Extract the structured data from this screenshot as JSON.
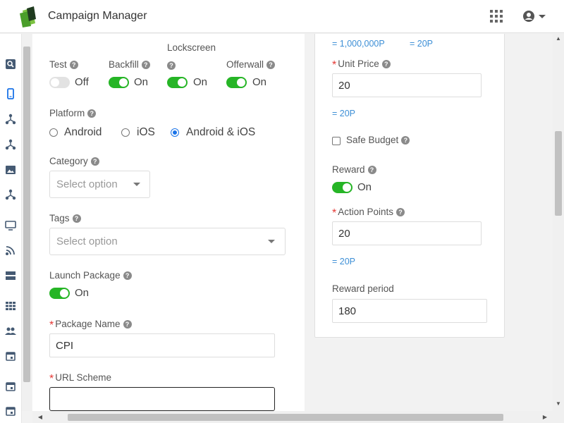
{
  "header": {
    "title": "Campaign Manager",
    "apps_icon": "grid-icon",
    "user_icon": "account-circle-icon"
  },
  "sidebar": {
    "icons": [
      "search-icon",
      "mobile-icon",
      "network-icon",
      "network-icon",
      "image-icon",
      "network-icon",
      "monitor-icon",
      "rss-icon",
      "storage-icon",
      "grid-icon",
      "people-icon",
      "calendar-icon",
      "calendar-icon",
      "calendar-icon"
    ]
  },
  "toggles": {
    "test": {
      "label": "Test",
      "state": "Off",
      "on": false
    },
    "backfill": {
      "label": "Backfill",
      "state": "On",
      "on": true
    },
    "lockscreen": {
      "label": "Lockscreen",
      "state": "On",
      "on": true
    },
    "offerwall": {
      "label": "Offerwall",
      "state": "On",
      "on": true
    }
  },
  "platform": {
    "label": "Platform",
    "options": [
      "Android",
      "iOS",
      "Android & iOS"
    ],
    "selected": "Android & iOS"
  },
  "category": {
    "label": "Category",
    "placeholder": "Select option"
  },
  "tags": {
    "label": "Tags",
    "placeholder": "Select option"
  },
  "launch_package": {
    "label": "Launch Package",
    "state": "On",
    "on": true
  },
  "package_name": {
    "label": "Package Name",
    "value": "CPI"
  },
  "url_scheme": {
    "label": "URL Scheme",
    "value": ""
  },
  "right": {
    "top_hint_1": "= 1,000,000P",
    "top_hint_2": "= 20P",
    "unit_price": {
      "label": "Unit Price",
      "value": "20",
      "hint": "= 20P"
    },
    "safe_budget": {
      "label": "Safe Budget",
      "checked": false
    },
    "reward": {
      "label": "Reward",
      "state": "On",
      "on": true
    },
    "action_points": {
      "label": "Action Points",
      "value": "20",
      "hint": "= 20P"
    },
    "reward_period": {
      "label": "Reward period",
      "value": "180"
    }
  },
  "colors": {
    "accent": "#26b526",
    "link": "#3d8fd6",
    "required": "#e53935",
    "radio": "#1a73e8"
  }
}
